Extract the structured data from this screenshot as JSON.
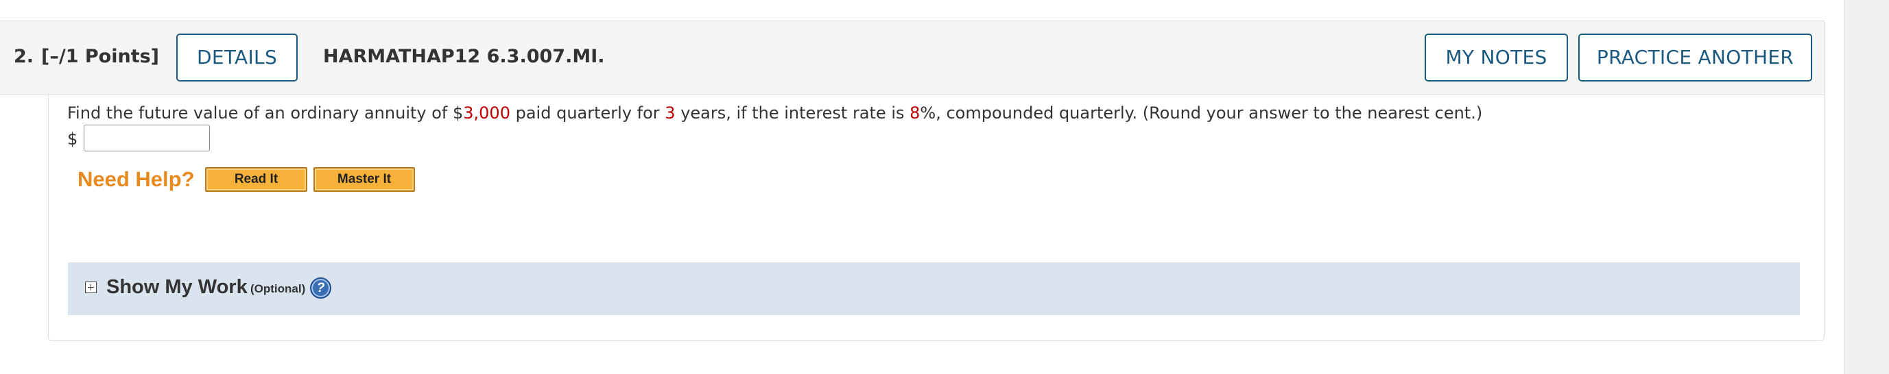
{
  "question": {
    "number": "2.",
    "points": "[–/1 Points]",
    "details_label": "DETAILS",
    "code": "HARMATHAP12 6.3.007.MI.",
    "my_notes_label": "MY NOTES",
    "practice_another_label": "PRACTICE ANOTHER"
  },
  "body": {
    "text_part1": "Find the future value of an ordinary annuity of $",
    "amount": "3,000",
    "text_part2": " paid quarterly for ",
    "years": "3",
    "text_part3": " years, if the interest rate is ",
    "rate": "8",
    "text_part4": "%, compounded quarterly. (Round your answer to the nearest cent.)",
    "currency_symbol": "$",
    "answer_value": ""
  },
  "help": {
    "label": "Need Help?",
    "read_it_label": "Read It",
    "master_it_label": "Master It"
  },
  "show_work": {
    "title": "Show My Work",
    "optional_label": "(Optional)",
    "help_icon": "question-circle-icon",
    "expand_icon": "plus-box-icon"
  },
  "colors": {
    "accent_blue": "#1a5a80",
    "value_red": "#c00000",
    "need_help_orange": "#e8891d",
    "help_button_orange": "#f6b13b",
    "show_work_bg": "#d9e4ee"
  }
}
